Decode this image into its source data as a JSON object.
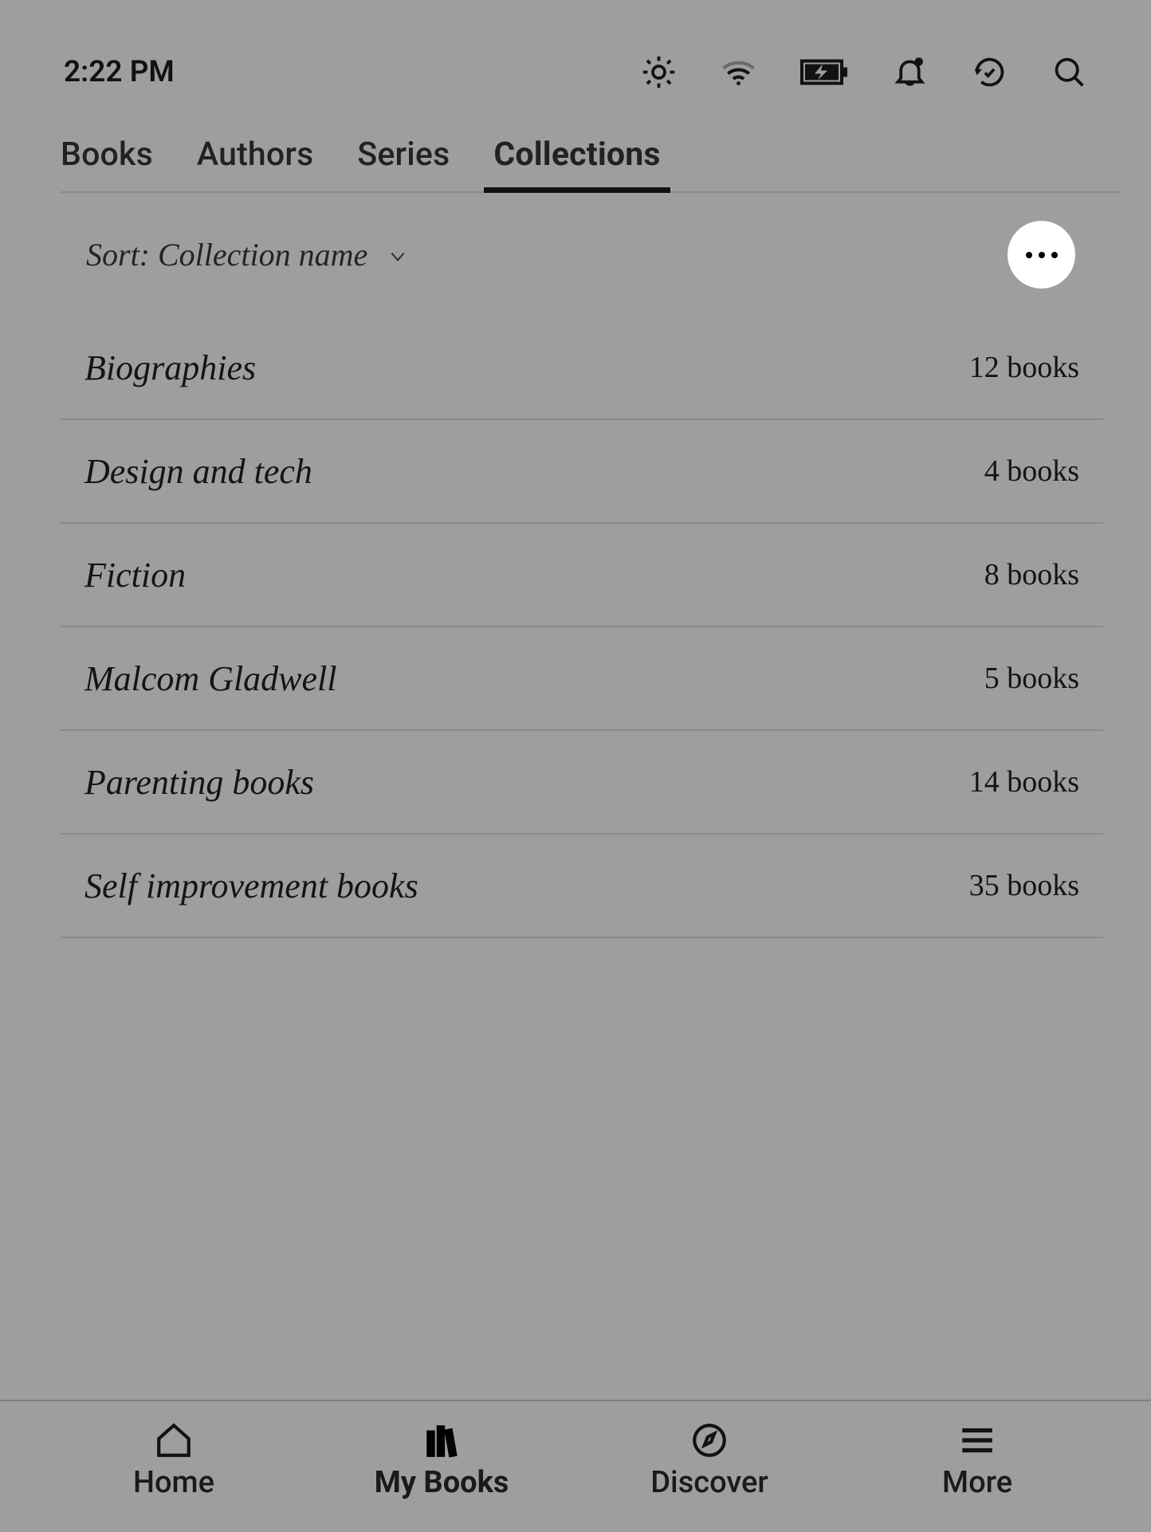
{
  "status": {
    "time": "2:22 PM"
  },
  "tabs": {
    "items": [
      {
        "label": "Books",
        "active": false
      },
      {
        "label": "Authors",
        "active": false
      },
      {
        "label": "Series",
        "active": false
      },
      {
        "label": "Collections",
        "active": true
      }
    ]
  },
  "sort": {
    "prefix": "Sort:",
    "value": "Collection name"
  },
  "collections": [
    {
      "name": "Biographies",
      "count": "12 books"
    },
    {
      "name": "Design and tech",
      "count": "4 books"
    },
    {
      "name": "Fiction",
      "count": "8 books"
    },
    {
      "name": "Malcom Gladwell",
      "count": "5 books"
    },
    {
      "name": "Parenting books",
      "count": "14 books"
    },
    {
      "name": "Self improvement books",
      "count": "35 books"
    }
  ],
  "nav": {
    "items": [
      {
        "label": "Home",
        "icon": "home",
        "active": false
      },
      {
        "label": "My Books",
        "icon": "books",
        "active": true
      },
      {
        "label": "Discover",
        "icon": "compass",
        "active": false
      },
      {
        "label": "More",
        "icon": "menu",
        "active": false
      }
    ]
  }
}
